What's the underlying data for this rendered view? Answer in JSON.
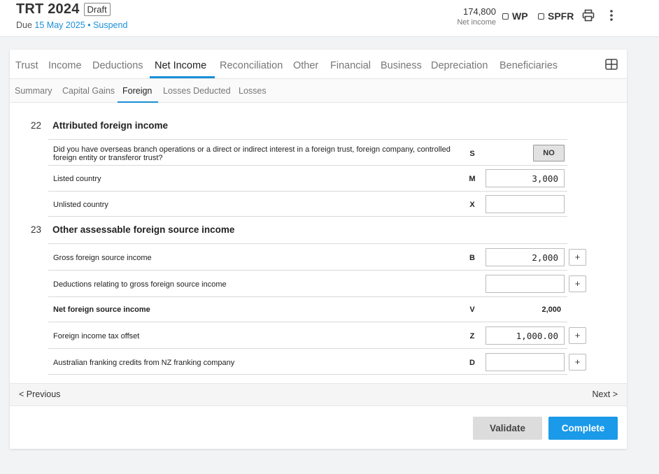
{
  "header": {
    "title": "TRT 2024",
    "status_badge": "Draft",
    "due_prefix": "Due",
    "due_date": "15 May 2025",
    "separator": "•",
    "suspend_link": "Suspend",
    "net_income_value": "174,800",
    "net_income_label": "Net income",
    "wp_label": "WP",
    "spfr_label": "SPFR",
    "print_icon": "printer-icon",
    "more_icon": "more-vertical-icon"
  },
  "tabs": [
    "Trust",
    "Income",
    "Deductions",
    "Net Income",
    "Reconciliation",
    "Other",
    "Financial",
    "Business",
    "Depreciation",
    "Beneficiaries"
  ],
  "active_tab": "Net Income",
  "subtabs": [
    "Summary",
    "Capital Gains",
    "Foreign",
    "Losses Deducted",
    "Losses"
  ],
  "active_subtab": "Foreign",
  "section22": {
    "number": "22",
    "title": "Attributed foreign income",
    "rows": [
      {
        "label": "Did you have overseas branch operations or a direct or indirect interest in a foreign trust, foreign company, controlled foreign entity or transferor trust?",
        "code": "S",
        "toggle": "NO"
      },
      {
        "label": "Listed country",
        "code": "M",
        "value": "3,000"
      },
      {
        "label": "Unlisted country",
        "code": "X",
        "value": ""
      }
    ]
  },
  "section23": {
    "number": "23",
    "title": "Other assessable foreign source income",
    "rows": [
      {
        "label": "Gross foreign source income",
        "code": "B",
        "value": "2,000",
        "plus": "+"
      },
      {
        "label": "Deductions relating to gross foreign source income",
        "code": "",
        "value": "",
        "plus": "+"
      },
      {
        "label": "Net foreign source income",
        "code": "V",
        "value": "2,000"
      },
      {
        "label": "Foreign income tax offset",
        "code": "Z",
        "value": "1,000.00",
        "plus": "+"
      },
      {
        "label": "Australian franking credits from NZ franking company",
        "code": "D",
        "value": "",
        "plus": "+"
      }
    ]
  },
  "nav": {
    "previous": "< Previous",
    "next": "Next >"
  },
  "actions": {
    "validate": "Validate",
    "complete": "Complete"
  },
  "colors": {
    "accent": "#1a8fd8",
    "complete_button": "#1a9ae8"
  }
}
